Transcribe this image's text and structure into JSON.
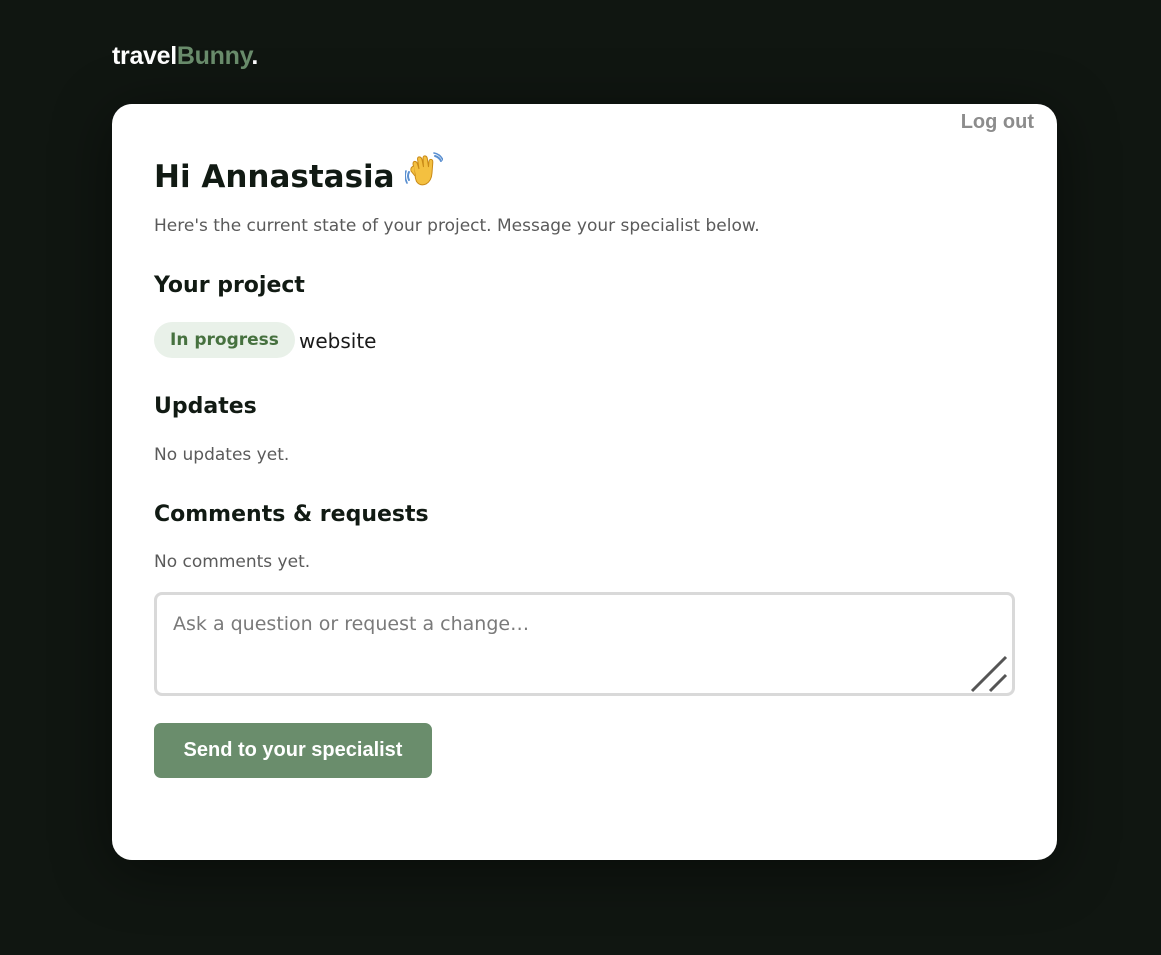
{
  "brand": {
    "part1": "travel",
    "part2": "Bunny",
    "part3": ".",
    "accent_color": "#6a8d6c"
  },
  "header": {
    "logout_label": "Log out"
  },
  "greeting": {
    "text": "Hi Annastasia",
    "icon": "waving-hand-icon"
  },
  "intro": "Here's the current state of your project. Message your specialist below.",
  "project": {
    "heading": "Your project",
    "status": "In progress",
    "name": "website"
  },
  "updates": {
    "heading": "Updates",
    "empty": "No updates yet."
  },
  "comments": {
    "heading": "Comments & requests",
    "empty": "No comments yet.",
    "placeholder": "Ask a question or request a change…",
    "value": "",
    "submit_label": "Send to your specialist"
  },
  "colors": {
    "page_bg": "#101611",
    "status_bg": "#e9f1e9",
    "status_text": "#46713f"
  }
}
